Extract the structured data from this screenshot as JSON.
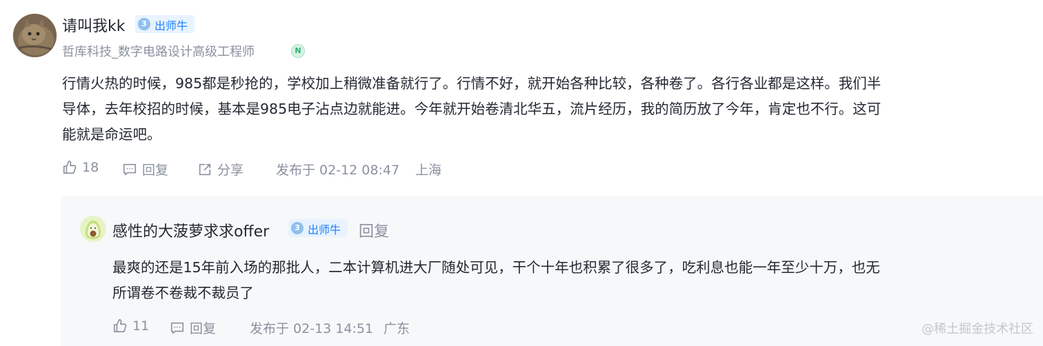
{
  "comment": {
    "username": "请叫我kk",
    "level_number": "3",
    "level_label": "出师牛",
    "job_title": "哲库科技_数字电路设计高级工程师",
    "badge_letter": "N",
    "lines": [
      "行情火热的时候，985都是秒抢的，学校加上稍微准备就行了。行情不好，就开始各种比较，各种卷了。各行各业都是这样。我们半",
      "导体，去年校招的时候，基本是985电子沾点边就能进。今年就开始卷清北华五，流片经历，我的简历放了今年，肯定也不行。这可",
      "能就是命运吧。"
    ],
    "like_count": "18",
    "reply_label": "回复",
    "share_label": "分享",
    "published": "发布于 02-12 08:47",
    "location": "上海"
  },
  "reply": {
    "username": "感性的大菠萝求求offer",
    "level_number": "3",
    "level_label": "出师牛",
    "reply_label": "回复",
    "lines": [
      "最爽的还是15年前入场的那批人，二本计算机进大厂随处可见，干个十年也积累了很多了，吃利息也能一年至少十万，也无",
      "所谓卷不卷裁不裁员了"
    ],
    "like_count": "11",
    "action_reply_label": "回复",
    "published": "发布于 02-13 14:51",
    "location": "广东"
  },
  "watermark": "@稀土掘金技术社区",
  "colors": {
    "text": "#252933",
    "muted": "#8a919f",
    "accent": "#1e80ff",
    "reply_bg": "#f7f8fa"
  },
  "icons": [
    "cat-avatar",
    "level-badge-icon",
    "n-badge-icon",
    "thumbs-up-icon",
    "comment-icon",
    "share-icon",
    "avocado-avatar"
  ]
}
